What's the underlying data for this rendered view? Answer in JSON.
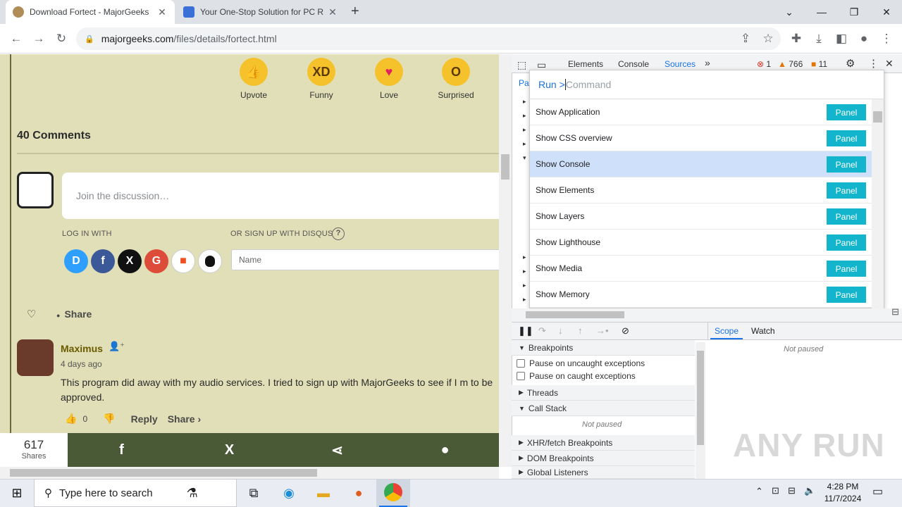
{
  "browser": {
    "tabs": [
      {
        "title": "Download Fortect - MajorGeeks",
        "active": true
      },
      {
        "title": "Your One-Stop Solution for PC R",
        "active": false
      }
    ],
    "new_tab": "+",
    "address": {
      "host": "majorgeeks.com",
      "path": "/files/details/fortect.html"
    }
  },
  "page": {
    "reactions": [
      {
        "label": "Upvote",
        "glyph": "👍"
      },
      {
        "label": "Funny",
        "glyph": "XD"
      },
      {
        "label": "Love",
        "glyph": "♥"
      },
      {
        "label": "Surprised",
        "glyph": "O"
      }
    ],
    "comments_title": "40 Comments",
    "discuss_placeholder": "Join the discussion…",
    "login_with": "LOG IN WITH",
    "signup": "OR SIGN UP WITH DISQUS",
    "help": "?",
    "sso": [
      {
        "name": "disqus",
        "letter": "D",
        "color": "#2e9fff"
      },
      {
        "name": "facebook",
        "letter": "f",
        "color": "#3b5998"
      },
      {
        "name": "x",
        "letter": "X",
        "color": "#111111"
      },
      {
        "name": "google",
        "letter": "G",
        "color": "#dd4b39"
      },
      {
        "name": "microsoft",
        "letter": "■",
        "color": "#ffffff"
      },
      {
        "name": "apple",
        "letter": "",
        "color": "#ffffff"
      }
    ],
    "name_placeholder": "Name",
    "share_label": "Share",
    "comment": {
      "user": "Maximus",
      "ago": "4 days ago",
      "text": "This program did away with my audio services. I tried to sign up with MajorGeeks to see if I m to be approved.",
      "likes": "0",
      "reply": "Reply",
      "share": "Share ›"
    },
    "share_count": "617",
    "share_count_label": "Shares"
  },
  "devtools": {
    "tabs": [
      "Elements",
      "Console",
      "Sources"
    ],
    "more": "»",
    "errors": "1",
    "warnings": "766",
    "issues": "11",
    "run_label": "Run >",
    "command_placeholder": "Command",
    "commands": [
      {
        "label": "Show Application",
        "badge": "Panel",
        "selected": false
      },
      {
        "label": "Show CSS overview",
        "badge": "Panel",
        "selected": false
      },
      {
        "label": "Show Console",
        "badge": "Panel",
        "selected": true
      },
      {
        "label": "Show Elements",
        "badge": "Panel",
        "selected": false
      },
      {
        "label": "Show Layers",
        "badge": "Panel",
        "selected": false
      },
      {
        "label": "Show Lighthouse",
        "badge": "Panel",
        "selected": false
      },
      {
        "label": "Show Media",
        "badge": "Panel",
        "selected": false
      },
      {
        "label": "Show Memory",
        "badge": "Panel",
        "selected": false
      }
    ],
    "page_tab_partial": "Pag",
    "scope_tab": "Scope",
    "watch_tab": "Watch",
    "not_paused": "Not paused",
    "sections": {
      "breakpoints": "Breakpoints",
      "pause_uncaught": "Pause on uncaught exceptions",
      "pause_caught": "Pause on caught exceptions",
      "threads": "Threads",
      "call_stack": "Call Stack",
      "call_stack_status": "Not paused",
      "xhr": "XHR/fetch Breakpoints",
      "dom": "DOM Breakpoints",
      "global": "Global Listeners"
    }
  },
  "taskbar": {
    "search_placeholder": "Type here to search",
    "time": "4:28 PM",
    "date": "11/7/2024"
  },
  "watermark": "ANY RUN"
}
